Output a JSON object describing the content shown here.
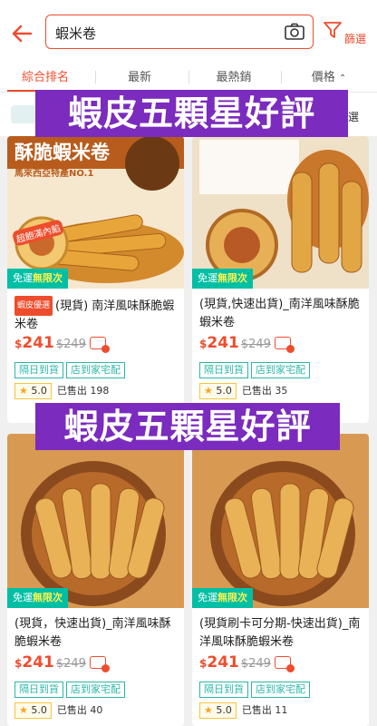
{
  "search": {
    "query": "蝦米卷"
  },
  "filter": {
    "label": "篩選"
  },
  "sort_tabs": [
    "綜合排名",
    "最新",
    "最熱銷",
    "價格"
  ],
  "subbar": {
    "tail_text": "選"
  },
  "banners": [
    "蝦皮五顆星好評",
    "蝦皮五顆星好評"
  ],
  "products": [
    {
      "badge": "蝦皮優選",
      "title": "(現貨) 南洋風味酥脆蝦米卷",
      "currency": "$",
      "price": "241",
      "old_price": "$249",
      "tags": [
        "隔日到貨",
        "店到家宅配"
      ],
      "rating": "5.0",
      "sold": "已售出 198",
      "free_ship_prefix": "免運",
      "free_ship_suffix": "無限次",
      "image_text": "酥脆蝦米卷",
      "image_sub": "馬來西亞特產NO.1",
      "image_bubble": "超飽滿內餡"
    },
    {
      "badge": "",
      "title": "(現貨,快速出貨)_南洋風味酥脆蝦米卷",
      "currency": "$",
      "price": "241",
      "old_price": "$249",
      "tags": [
        "隔日到貨",
        "店到家宅配"
      ],
      "rating": "5.0",
      "sold": "已售出 35",
      "free_ship_prefix": "免運",
      "free_ship_suffix": "無限次"
    },
    {
      "badge": "",
      "title": "(現貨，快速出貨)_南洋風味酥脆蝦米卷",
      "currency": "$",
      "price": "241",
      "old_price": "$249",
      "tags": [
        "隔日到貨",
        "店到家宅配"
      ],
      "rating": "5.0",
      "sold": "已售出 40",
      "free_ship_prefix": "免運",
      "free_ship_suffix": "無限次"
    },
    {
      "badge": "",
      "title": "(現貨刷卡可分期-快速出貨)_南洋風味酥脆蝦米卷",
      "currency": "$",
      "price": "241",
      "old_price": "$249",
      "tags": [
        "隔日到貨",
        "店到家宅配"
      ],
      "rating": "5.0",
      "sold": "已售出 11",
      "free_ship_prefix": "免運",
      "free_ship_suffix": "無限次"
    }
  ],
  "colors": {
    "brand": "#ee4d2d",
    "banner": "#7b2bbd",
    "free_ship": "#00bfa5",
    "tag": "#2bb7a8"
  }
}
